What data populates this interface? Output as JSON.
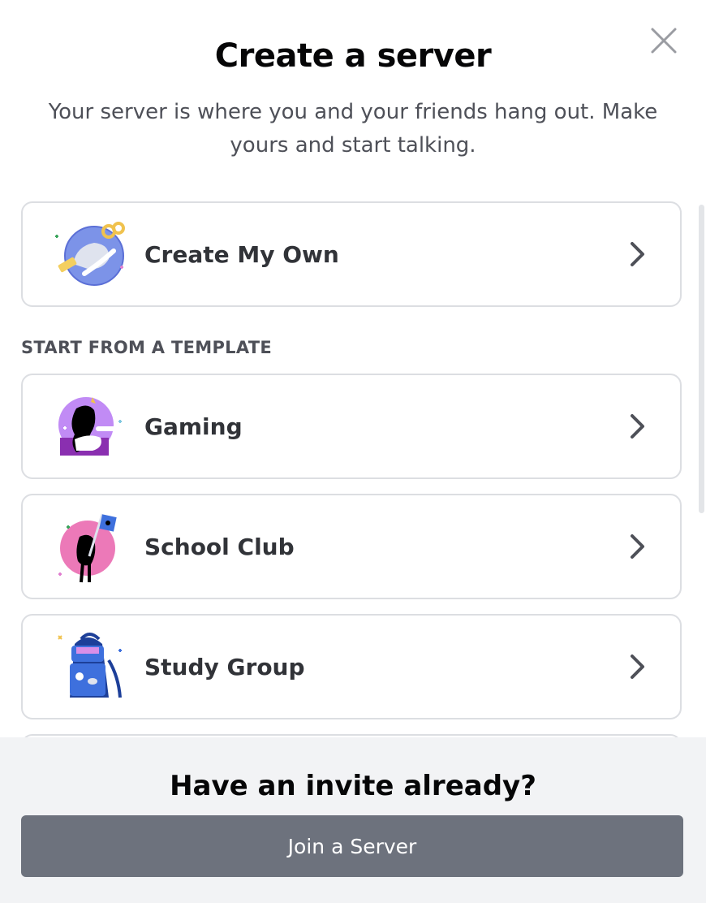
{
  "modal": {
    "title": "Create a server",
    "subtitle": "Your server is where you and your friends hang out. Make yours and start talking."
  },
  "options": {
    "create_own": {
      "label": "Create My Own",
      "icon": "create-my-own-illustration"
    },
    "section_label": "START FROM A TEMPLATE",
    "templates": [
      {
        "label": "Gaming",
        "icon": "gaming-illustration"
      },
      {
        "label": "School Club",
        "icon": "school-club-illustration"
      },
      {
        "label": "Study Group",
        "icon": "study-group-illustration"
      }
    ]
  },
  "footer": {
    "title": "Have an invite already?",
    "join_label": "Join a Server"
  },
  "colors": {
    "card_border": "#dcdee2",
    "footer_bg": "#f2f3f5",
    "join_button": "#6d727d",
    "card_text": "#313338"
  }
}
